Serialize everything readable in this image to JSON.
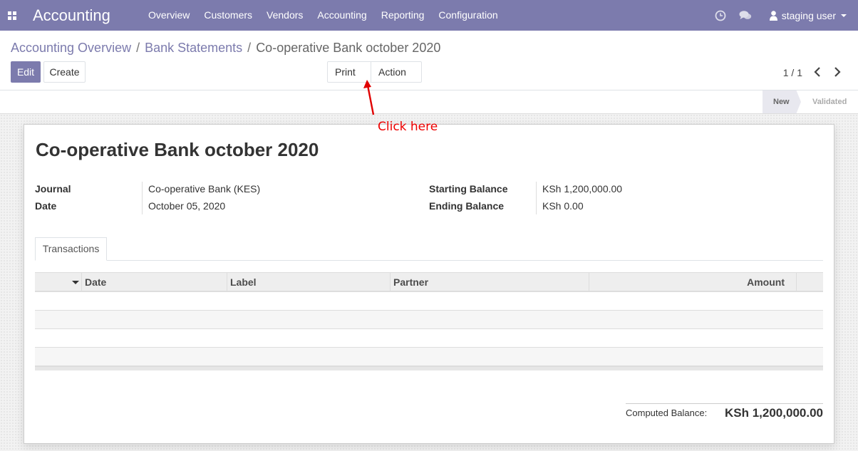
{
  "navbar": {
    "brand": "Accounting",
    "menu": [
      "Overview",
      "Customers",
      "Vendors",
      "Accounting",
      "Reporting",
      "Configuration"
    ],
    "user": "staging user",
    "icons": [
      "apps-icon",
      "clock-icon",
      "chat-icon",
      "user-icon"
    ]
  },
  "breadcrumb": {
    "items": [
      "Accounting Overview",
      "Bank Statements"
    ],
    "separator": "/",
    "current": "Co-operative Bank october 2020"
  },
  "buttons": {
    "edit": "Edit",
    "create": "Create",
    "print": "Print",
    "action": "Action"
  },
  "pager": "1 / 1",
  "status": {
    "stages": [
      "New",
      "Validated"
    ],
    "active": "New"
  },
  "form": {
    "title": "Co-operative Bank october 2020",
    "journal_label": "Journal",
    "journal_value": "Co-operative Bank (KES)",
    "date_label": "Date",
    "date_value": "October 05, 2020",
    "starting_balance_label": "Starting Balance",
    "starting_balance_value": "KSh 1,200,000.00",
    "ending_balance_label": "Ending Balance",
    "ending_balance_value": "KSh 0.00"
  },
  "tabs": [
    "Transactions"
  ],
  "table": {
    "columns": [
      "Date",
      "Label",
      "Partner",
      "Amount"
    ],
    "rows": []
  },
  "computed_balance": {
    "label": "Computed Balance:",
    "value": "KSh 1,200,000.00"
  },
  "annotation": {
    "text": "Click here",
    "color": "#e00000"
  },
  "colors": {
    "brand": "#7c7bad"
  }
}
